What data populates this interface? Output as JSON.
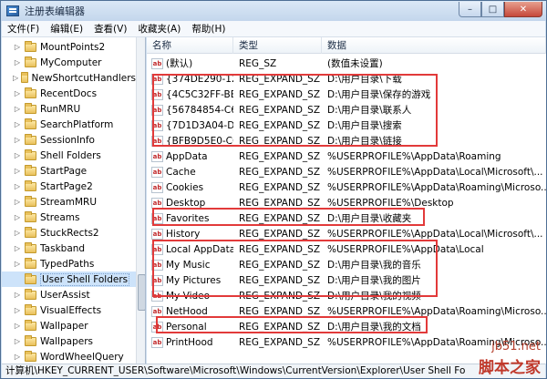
{
  "window": {
    "title": "注册表编辑器",
    "controls": {
      "minimize": "–",
      "maximize": "□",
      "close": "✕"
    }
  },
  "menu": [
    "文件(F)",
    "编辑(E)",
    "查看(V)",
    "收藏夹(A)",
    "帮助(H)"
  ],
  "tree": {
    "items": [
      {
        "label": "MountPoints2",
        "selected": false
      },
      {
        "label": "MyComputer",
        "selected": false
      },
      {
        "label": "NewShortcutHandlers",
        "selected": false
      },
      {
        "label": "RecentDocs",
        "selected": false
      },
      {
        "label": "RunMRU",
        "selected": false
      },
      {
        "label": "SearchPlatform",
        "selected": false
      },
      {
        "label": "SessionInfo",
        "selected": false
      },
      {
        "label": "Shell Folders",
        "selected": false
      },
      {
        "label": "StartPage",
        "selected": false
      },
      {
        "label": "StartPage2",
        "selected": false
      },
      {
        "label": "StreamMRU",
        "selected": false
      },
      {
        "label": "Streams",
        "selected": false
      },
      {
        "label": "StuckRects2",
        "selected": false
      },
      {
        "label": "Taskband",
        "selected": false
      },
      {
        "label": "TypedPaths",
        "selected": false
      },
      {
        "label": "User Shell Folders",
        "selected": true
      },
      {
        "label": "UserAssist",
        "selected": false
      },
      {
        "label": "VisualEffects",
        "selected": false
      },
      {
        "label": "Wallpaper",
        "selected": false
      },
      {
        "label": "Wallpapers",
        "selected": false
      },
      {
        "label": "WordWheelQuery",
        "selected": false
      }
    ]
  },
  "list": {
    "headers": [
      "名称",
      "类型",
      "数据"
    ],
    "rows": [
      {
        "name": "(默认)",
        "type": "REG_SZ",
        "data": "(数值未设置)"
      },
      {
        "name": "{374DE290-12...",
        "type": "REG_EXPAND_SZ",
        "data": "D:\\用户目录\\下载"
      },
      {
        "name": "{4C5C32FF-BB...",
        "type": "REG_EXPAND_SZ",
        "data": "D:\\用户目录\\保存的游戏"
      },
      {
        "name": "{56784854-C6...",
        "type": "REG_EXPAND_SZ",
        "data": "D:\\用户目录\\联系人"
      },
      {
        "name": "{7D1D3A04-DE...",
        "type": "REG_EXPAND_SZ",
        "data": "D:\\用户目录\\搜索"
      },
      {
        "name": "{BFB9D5E0-C6...",
        "type": "REG_EXPAND_SZ",
        "data": "D:\\用户目录\\链接"
      },
      {
        "name": "AppData",
        "type": "REG_EXPAND_SZ",
        "data": "%USERPROFILE%\\AppData\\Roaming"
      },
      {
        "name": "Cache",
        "type": "REG_EXPAND_SZ",
        "data": "%USERPROFILE%\\AppData\\Local\\Microsoft\\..."
      },
      {
        "name": "Cookies",
        "type": "REG_EXPAND_SZ",
        "data": "%USERPROFILE%\\AppData\\Roaming\\Microso..."
      },
      {
        "name": "Desktop",
        "type": "REG_EXPAND_SZ",
        "data": "%USERPROFILE%\\Desktop"
      },
      {
        "name": "Favorites",
        "type": "REG_EXPAND_SZ",
        "data": "D:\\用户目录\\收藏夹"
      },
      {
        "name": "History",
        "type": "REG_EXPAND_SZ",
        "data": "%USERPROFILE%\\AppData\\Local\\Microsoft\\..."
      },
      {
        "name": "Local AppData",
        "type": "REG_EXPAND_SZ",
        "data": "%USERPROFILE%\\AppData\\Local"
      },
      {
        "name": "My Music",
        "type": "REG_EXPAND_SZ",
        "data": "D:\\用户目录\\我的音乐"
      },
      {
        "name": "My Pictures",
        "type": "REG_EXPAND_SZ",
        "data": "D:\\用户目录\\我的图片"
      },
      {
        "name": "My Video",
        "type": "REG_EXPAND_SZ",
        "data": "D:\\用户目录\\我的视频"
      },
      {
        "name": "NetHood",
        "type": "REG_EXPAND_SZ",
        "data": "%USERPROFILE%\\AppData\\Roaming\\Microso..."
      },
      {
        "name": "Personal",
        "type": "REG_EXPAND_SZ",
        "data": "D:\\用户目录\\我的文档"
      },
      {
        "name": "PrintHood",
        "type": "REG_EXPAND_SZ",
        "data": "%USERPROFILE%\\AppData\\Roaming\\Microso..."
      }
    ]
  },
  "status_bar": "计算机\\HKEY_CURRENT_USER\\Software\\Microsoft\\Windows\\CurrentVersion\\Explorer\\User Shell Fo",
  "watermark": {
    "site": "jb51.net",
    "brand": "脚本之家"
  },
  "colors": {
    "highlight_box": "#e23a3a",
    "selection": "#cde3fa"
  }
}
